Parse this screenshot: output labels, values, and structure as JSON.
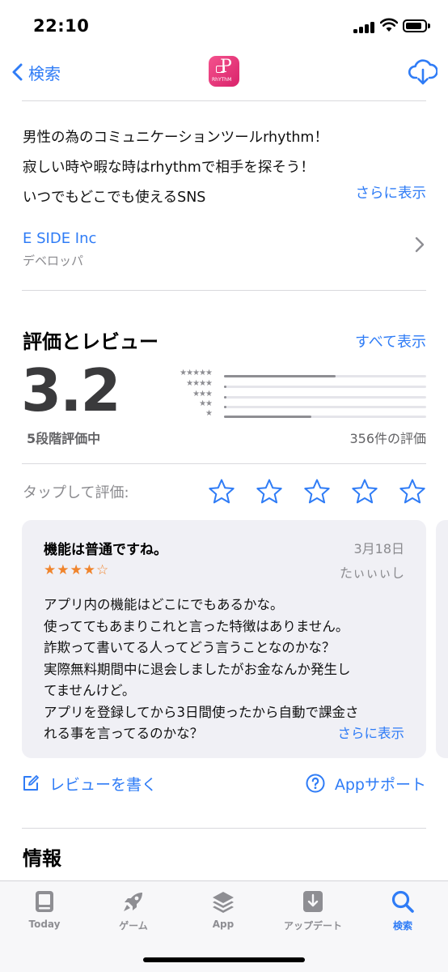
{
  "status_bar": {
    "time": "22:10"
  },
  "nav": {
    "back_label": "検索",
    "app_icon_text": "RhYThM"
  },
  "description": {
    "lines": [
      "男性の為のコミュニケーションツールrhythm！",
      "寂しい時や暇な時はrhythmで相手を探そう！",
      "いつでもどこでも使えるSNS"
    ],
    "more_label": "さらに表示"
  },
  "developer": {
    "name": "E SIDE Inc",
    "label": "デベロッパ"
  },
  "ratings": {
    "title": "評価とレビュー",
    "see_all_label": "すべて表示",
    "score": "3.2",
    "out_of": "5段階評価中",
    "count_label": "356件の評価",
    "histogram": [
      {
        "stars": "★★★★★",
        "fraction": 0.55
      },
      {
        "stars": "★★★★",
        "fraction": 0.01
      },
      {
        "stars": "★★★",
        "fraction": 0.01
      },
      {
        "stars": "★★",
        "fraction": 0.01
      },
      {
        "stars": "★",
        "fraction": 0.43
      }
    ]
  },
  "tap_to_rate": {
    "label": "タップして評価:"
  },
  "review": {
    "title": "機能は普通ですね。",
    "date": "3月18日",
    "author": "たぃぃぃし",
    "stars": "★★★★☆",
    "rating": 4,
    "lines": [
      "アプリ内の機能はどこにでもあるかな。",
      "使っててもあまりこれと言った特徴はありません。",
      "詐欺って書いてる人ってどう言うことなのかな？",
      "実際無料期間中に退会しましたがお金なんか発生し",
      "てませんけど。",
      "アプリを登録してから3日間使ったから自動で課金さ",
      "れる事を言ってるのかな？"
    ],
    "more_label": "さらに表示"
  },
  "actions": {
    "write_review": "レビューを書く",
    "app_support": "Appサポート"
  },
  "info": {
    "title": "情報"
  },
  "tabbar": {
    "tabs": [
      {
        "label": "Today",
        "icon": "today-icon"
      },
      {
        "label": "ゲーム",
        "icon": "rocket-icon"
      },
      {
        "label": "App",
        "icon": "layers-icon"
      },
      {
        "label": "アップデート",
        "icon": "download-tray-icon"
      },
      {
        "label": "検索",
        "icon": "search-icon",
        "active": true
      }
    ]
  },
  "colors": {
    "accent": "#2f7cf6",
    "review_star": "#f0842c",
    "card_bg": "#f0f0f5"
  }
}
